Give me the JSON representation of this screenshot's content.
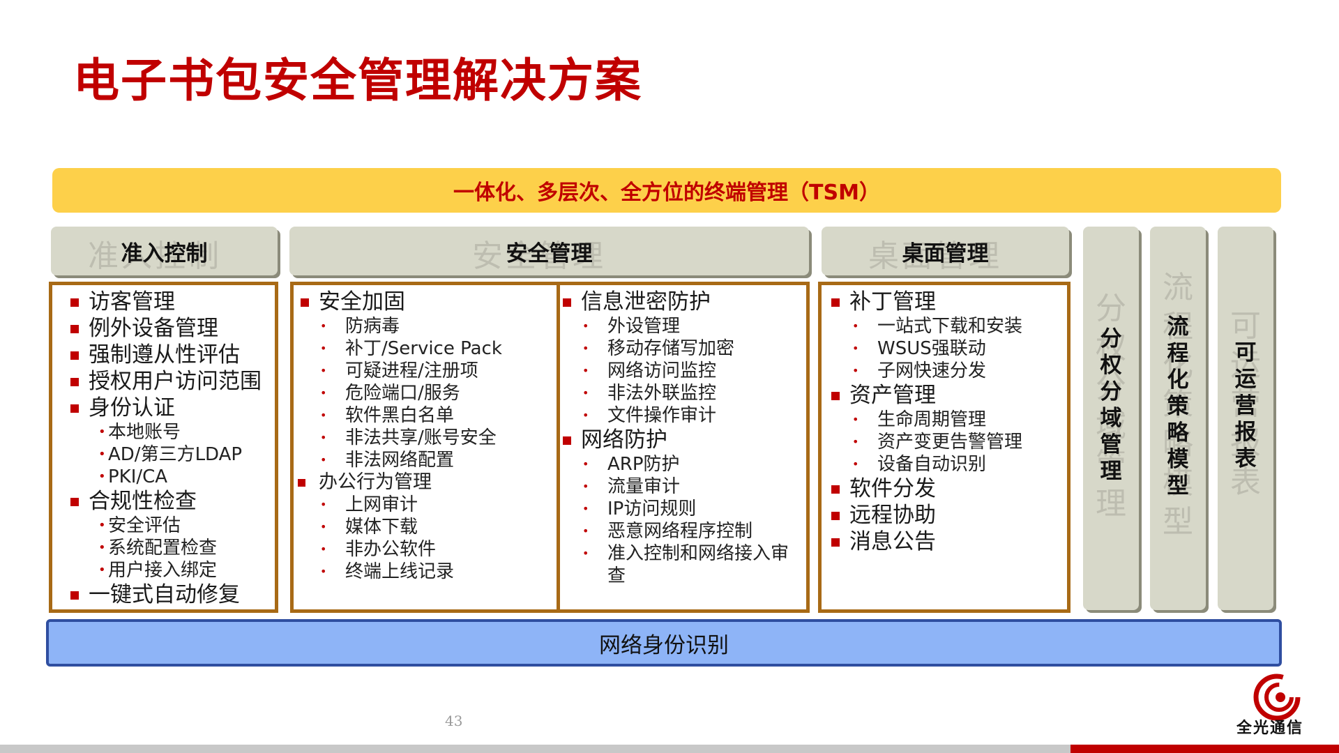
{
  "title": "电子书包安全管理解决方案",
  "banner": "一体化、多层次、全方位的终端管理（TSM）",
  "columns": {
    "access": {
      "header": "准入控制",
      "ghost": "准入控制"
    },
    "security": {
      "header": "安全管理",
      "ghost": "安全管理"
    },
    "desktop": {
      "header": "桌面管理",
      "ghost": "桌面管理"
    }
  },
  "access_items": {
    "i1": "访客管理",
    "i2": "例外设备管理",
    "i3": "强制遵从性评估",
    "i4": "授权用户访问范围",
    "i5": "身份认证",
    "i5a": "本地账号",
    "i5b": "AD/第三方LDAP",
    "i5c": "PKI/CA",
    "i6": "合规性检查",
    "i6a": "安全评估",
    "i6b": "系统配置检查",
    "i6c": "用户接入绑定",
    "i7": "一键式自动修复"
  },
  "security_left": {
    "g1": "安全加固",
    "g1_items": [
      "防病毒",
      "补丁/Service Pack",
      "可疑进程/注册项",
      "危险端口/服务",
      "软件黑白名单",
      "非法共享/账号安全",
      "非法网络配置"
    ],
    "g2": "办公行为管理",
    "g2_items": [
      "上网审计",
      "媒体下载",
      "非办公软件",
      "终端上线记录"
    ]
  },
  "security_right": {
    "g1": "信息泄密防护",
    "g1_items": [
      "外设管理",
      "移动存储写加密",
      "网络访问监控",
      "非法外联监控",
      "文件操作审计"
    ],
    "g2": "网络防护",
    "g2_items": [
      "ARP防护",
      "流量审计",
      "IP访问规则",
      "恶意网络程序控制",
      "准入控制和网络接入审",
      "查"
    ]
  },
  "desktop_items": {
    "g1": "补丁管理",
    "g1_items": [
      "一站式下载和安装",
      "WSUS强联动",
      "子网快速分发"
    ],
    "g2": "资产管理",
    "g2_items": [
      "生命周期管理",
      "资产变更告警管理",
      "设备自动识别"
    ],
    "g3": "软件分发",
    "g4": "远程协助",
    "g5": "消息公告"
  },
  "vertical": {
    "v1": [
      "分",
      "权",
      "分",
      "域",
      "管",
      "理"
    ],
    "v2": [
      "流",
      "程",
      "化",
      "策",
      "略",
      "模",
      "型"
    ],
    "v3": [
      "可",
      "运",
      "营",
      "报",
      "表"
    ]
  },
  "footer": "网络身份识别",
  "page_number": "43",
  "logo_text": "全光通信",
  "colors": {
    "title": "#c00000",
    "banner_bg": "#fdd04a",
    "header_bg": "#d7d8c9",
    "box_border": "#a86a16",
    "footer_bg": "#8eb4f7"
  }
}
